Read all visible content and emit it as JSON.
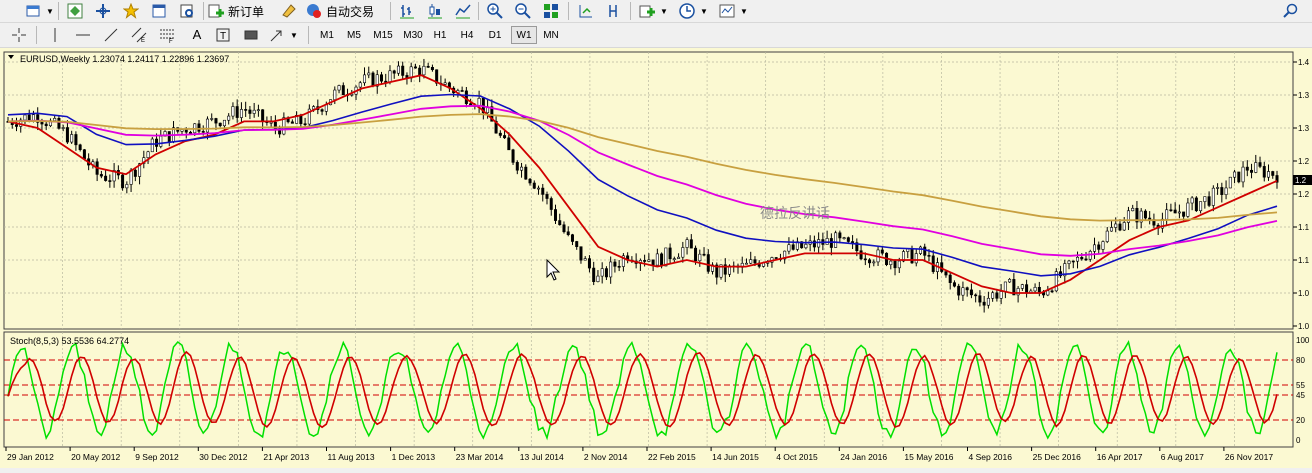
{
  "toolbar": {
    "new_order_label": "新订单",
    "autotrade_label": "自动交易"
  },
  "timeframes": [
    "M1",
    "M5",
    "M15",
    "M30",
    "H1",
    "H4",
    "D1",
    "W1",
    "MN"
  ],
  "active_timeframe": "W1",
  "chart": {
    "symbol_info": "EURUSD,Weekly  1.23074 1.24117 1.22896 1.23697",
    "watermark": "德拉反讲话",
    "price_axis_labels": [
      "1.4",
      "1.3",
      "1.3",
      "1.2",
      "1.2",
      "1.1",
      "1.1",
      "1.0",
      "1.0"
    ],
    "current_price_label": "1.2",
    "date_labels": [
      "29 Jan 2012",
      "20 May 2012",
      "9 Sep 2012",
      "30 Dec 2012",
      "21 Apr 2013",
      "11 Aug 2013",
      "1 Dec 2013",
      "23 Mar 2014",
      "13 Jul 2014",
      "2 Nov 2014",
      "22 Feb 2015",
      "14 Jun 2015",
      "4 Oct 2015",
      "24 Jan 2016",
      "15 May 2016",
      "4 Sep 2016",
      "25 Dec 2016",
      "16 Apr 2017",
      "6 Aug 2017",
      "26 Nov 2017"
    ],
    "colors": {
      "background": "#fbf9d2",
      "candle": "#000000",
      "ma_fast": "#d00000",
      "ma_mid": "#1010c0",
      "ma_slow": "#e000e0",
      "ma_long": "#c8a040",
      "stoch_main": "#00e000",
      "stoch_signal": "#d00000",
      "level": "#d00000"
    }
  },
  "stoch": {
    "info": "Stoch(8,5,3) 53.5536 64.2774",
    "levels": [
      "100",
      "80",
      "55",
      "45",
      "20",
      "0"
    ]
  },
  "chart_data": [
    {
      "type": "line",
      "title": "EURUSD,Weekly",
      "series": [
        {
          "values": [
            1.31,
            1.32,
            1.29,
            1.23,
            1.22,
            1.28,
            1.3,
            1.31,
            1.33,
            1.3,
            1.31,
            1.35,
            1.37,
            1.38,
            1.39,
            1.36,
            1.34,
            1.26,
            1.21,
            1.13,
            1.07,
            1.11,
            1.1,
            1.12,
            1.08,
            1.09,
            1.11,
            1.12,
            1.13,
            1.11,
            1.1,
            1.11,
            1.06,
            1.04,
            1.06,
            1.05,
            1.09,
            1.13,
            1.17,
            1.16,
            1.18,
            1.2,
            1.24,
            1.23
          ]
        },
        {
          "values": [
            1.31,
            1.3,
            1.27,
            1.24,
            1.23,
            1.26,
            1.28,
            1.29,
            1.31,
            1.31,
            1.32,
            1.34,
            1.36,
            1.37,
            1.38,
            1.36,
            1.33,
            1.29,
            1.24,
            1.18,
            1.12,
            1.1,
            1.09,
            1.1,
            1.09,
            1.09,
            1.1,
            1.11,
            1.11,
            1.11,
            1.1,
            1.1,
            1.08,
            1.06,
            1.05,
            1.05,
            1.07,
            1.1,
            1.13,
            1.15,
            1.16,
            1.18,
            1.2,
            1.22
          ]
        }
      ]
    }
  ]
}
